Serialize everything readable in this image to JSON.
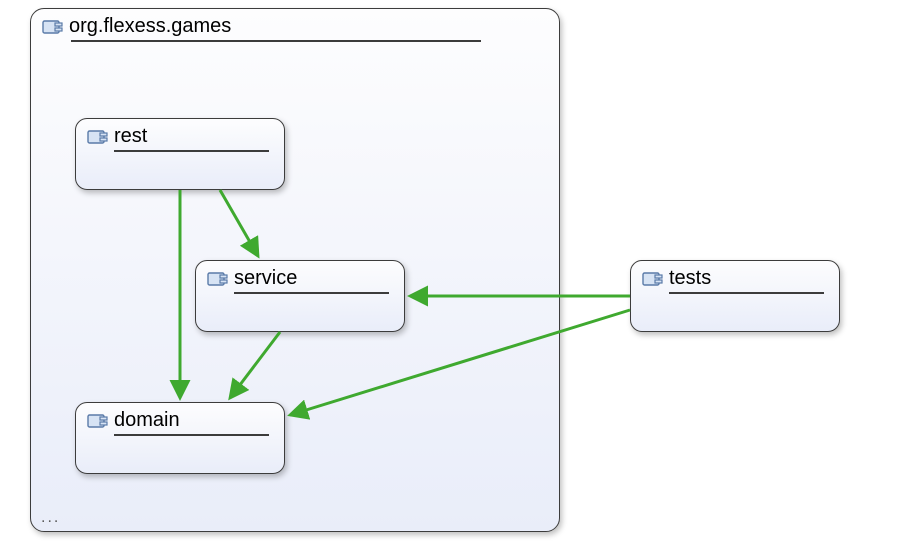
{
  "package": {
    "name": "org.flexess.games",
    "ellipsis": "..."
  },
  "nodes": {
    "rest": {
      "label": "rest"
    },
    "service": {
      "label": "service"
    },
    "domain": {
      "label": "domain"
    },
    "tests": {
      "label": "tests"
    }
  },
  "edges": [
    {
      "from": "rest",
      "to": "service"
    },
    {
      "from": "rest",
      "to": "domain"
    },
    {
      "from": "service",
      "to": "domain"
    },
    {
      "from": "tests",
      "to": "service"
    },
    {
      "from": "tests",
      "to": "domain"
    }
  ],
  "icon_name": "package-icon",
  "colors": {
    "arrow": "#3fa92f",
    "border": "#3c3c3c",
    "icon_fill": "#d7e3f4",
    "icon_stroke": "#5a7aa8"
  }
}
